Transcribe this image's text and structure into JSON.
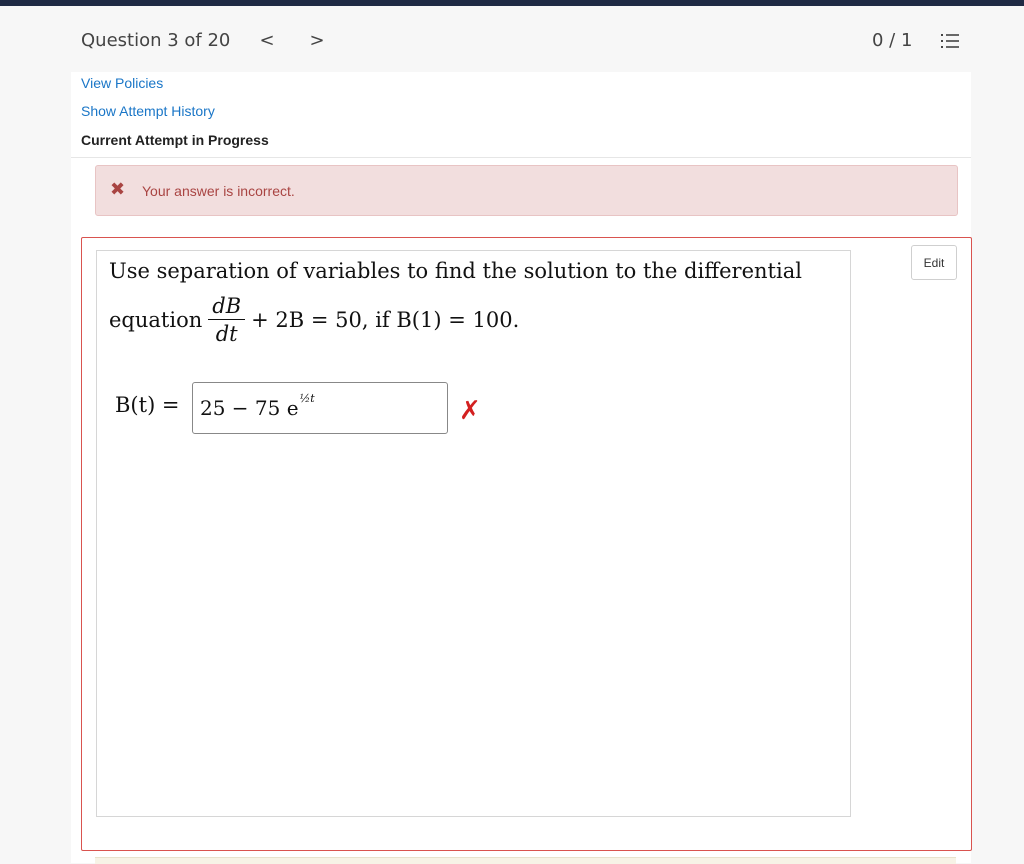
{
  "header": {
    "question_label": "Question 3 of 20",
    "prev_glyph": "<",
    "next_glyph": ">",
    "score": "0 / 1"
  },
  "links": {
    "view_policies": "View Policies",
    "attempt_history": "Show Attempt History",
    "current_attempt": "Current Attempt in Progress"
  },
  "alert": {
    "icon": "✖",
    "message": "Your answer is incorrect."
  },
  "question": {
    "edit_label": "Edit",
    "line1": "Use separation of variables to find the solution to the differential",
    "equation_word": "equation",
    "frac_num": "dB",
    "frac_den": "dt",
    "eq_rest": "+ 2B = 50,  if B(1) = 100."
  },
  "answer": {
    "label": "B(t) =",
    "value_main": "25 − 75 e",
    "value_exp": "½t",
    "result_mark": "✗"
  },
  "colors": {
    "accent_link": "#1a76c7",
    "error": "#d32020",
    "alert_bg": "#f2dede"
  }
}
